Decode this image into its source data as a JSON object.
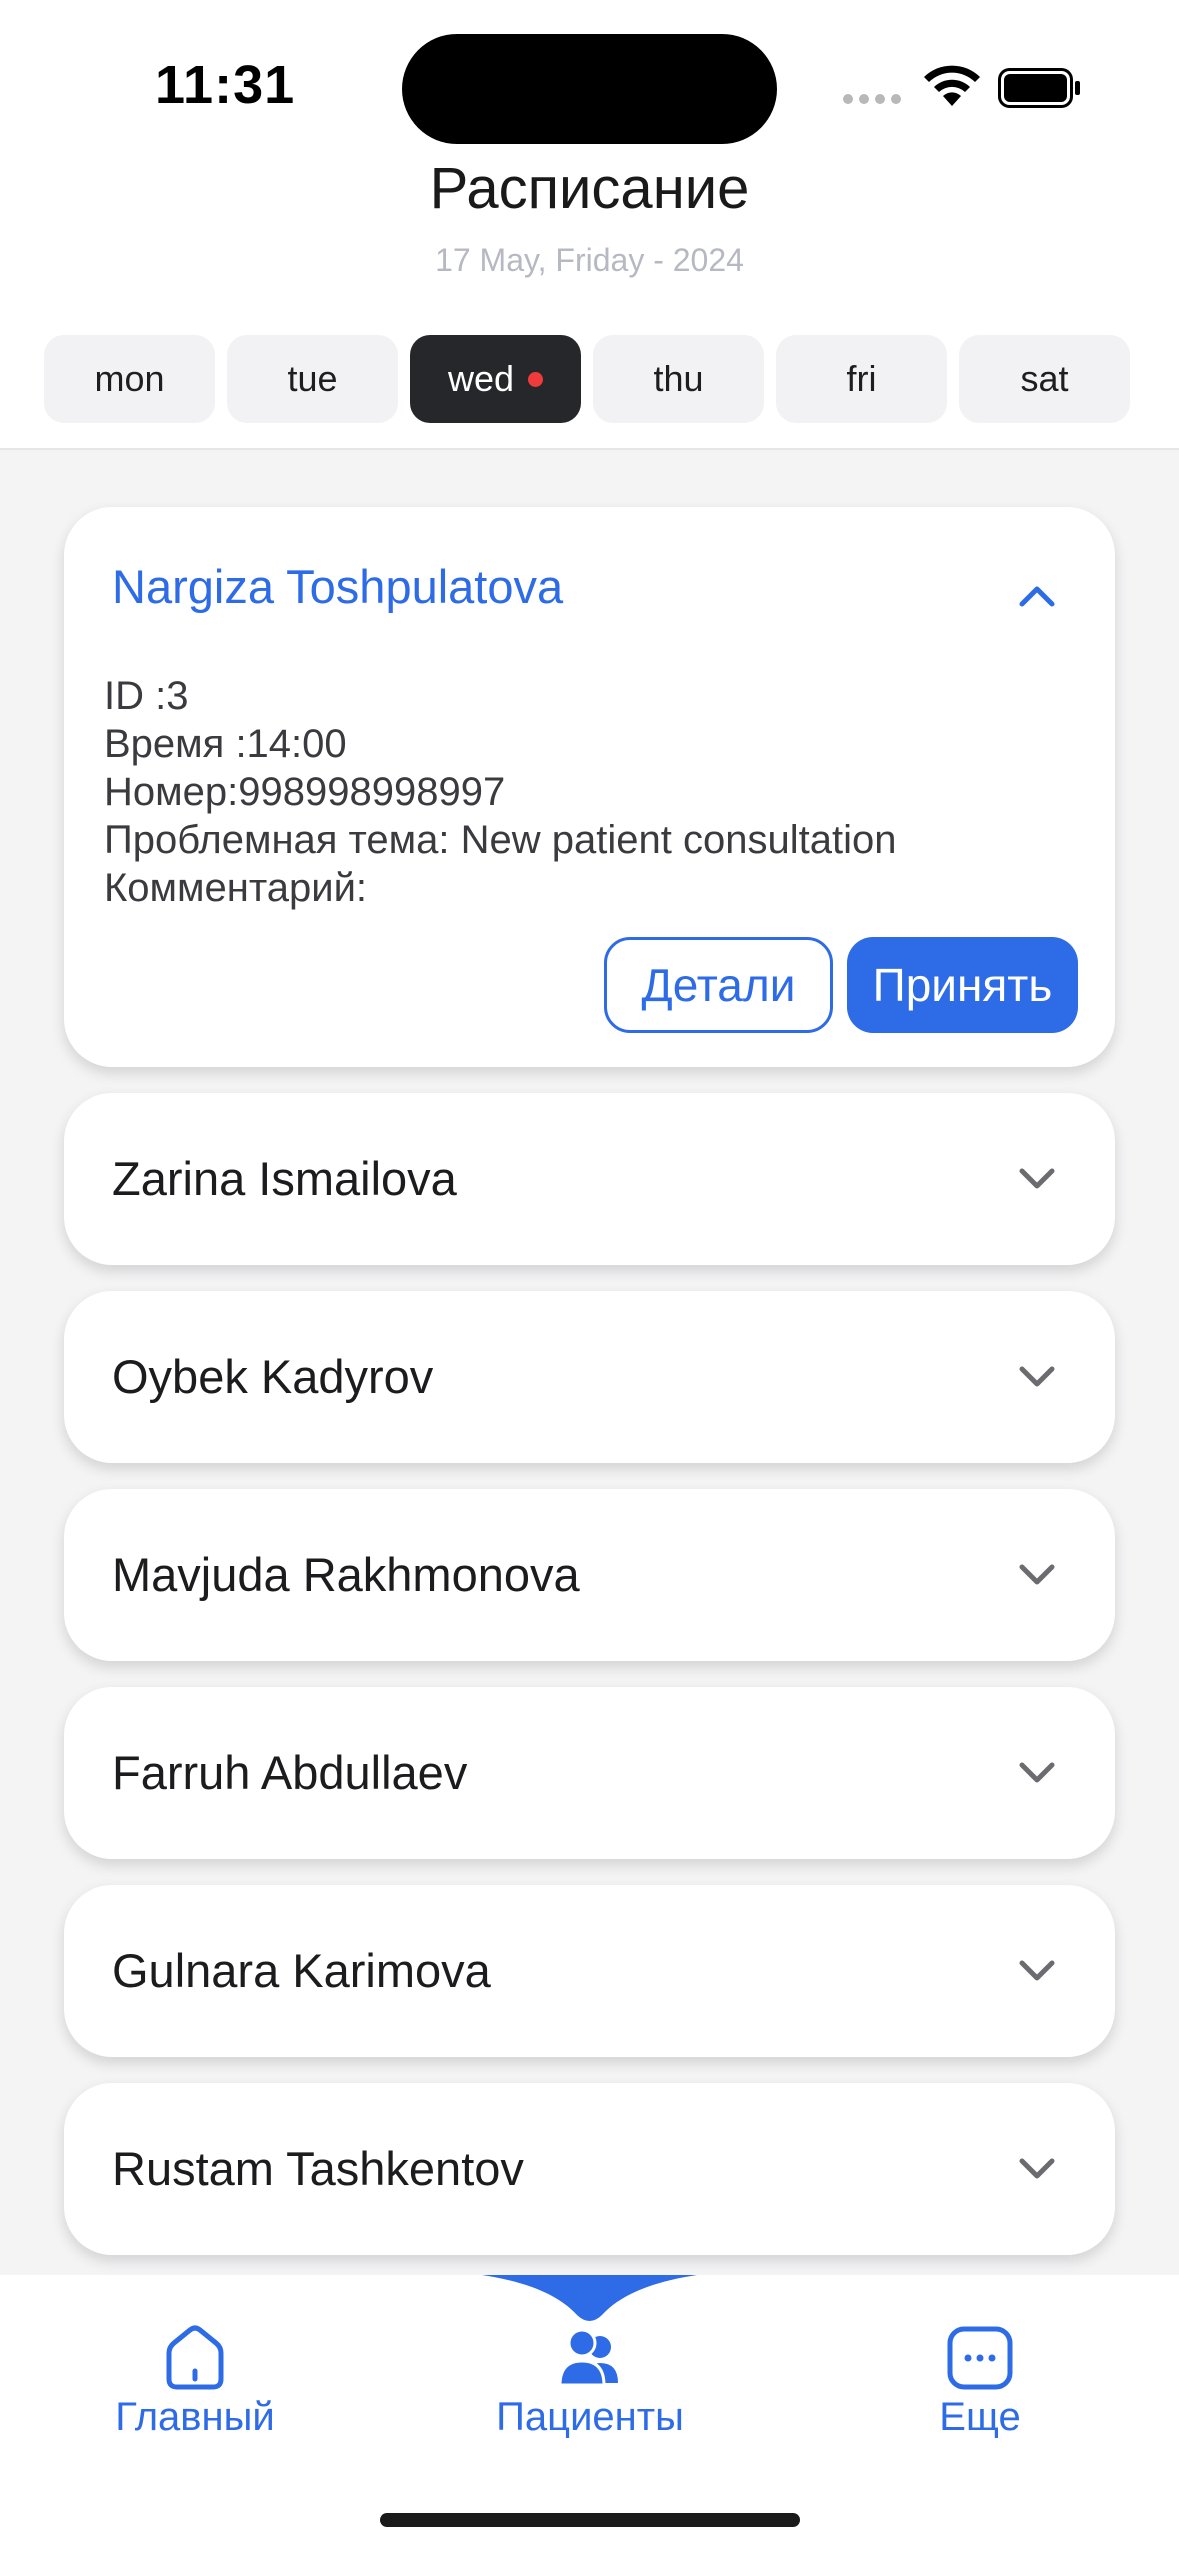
{
  "status_bar": {
    "time": "11:31"
  },
  "header": {
    "title": "Расписание",
    "date": "17 May, Friday - 2024"
  },
  "days": [
    {
      "label": "mon",
      "active": false
    },
    {
      "label": "tue",
      "active": false
    },
    {
      "label": "wed",
      "active": true,
      "has_dot": true
    },
    {
      "label": "thu",
      "active": false
    },
    {
      "label": "fri",
      "active": false
    },
    {
      "label": "sat",
      "active": false
    }
  ],
  "patients": [
    {
      "name": "Nargiza Toshpulatova",
      "expanded": true,
      "id_line": "ID :3",
      "time_line": "Время :14:00",
      "phone_line": "Номер:998998998997",
      "topic_line": "Проблемная тема: New patient consultation",
      "comment_line": "Комментарий:",
      "details_label": "Детали",
      "accept_label": "Принять"
    },
    {
      "name": "Zarina Ismailova",
      "expanded": false
    },
    {
      "name": "Oybek Kadyrov",
      "expanded": false
    },
    {
      "name": "Mavjuda Rakhmonova",
      "expanded": false
    },
    {
      "name": "Farruh Abdullaev",
      "expanded": false
    },
    {
      "name": "Gulnara Karimova",
      "expanded": false
    },
    {
      "name": "Rustam Tashkentov",
      "expanded": false
    }
  ],
  "nav": {
    "home": "Главный",
    "patients": "Пациенты",
    "more": "Еще",
    "active": "patients"
  },
  "colors": {
    "accent": "#2e6be6",
    "active_tab": "#26272b",
    "dot": "#ef3b3b"
  }
}
